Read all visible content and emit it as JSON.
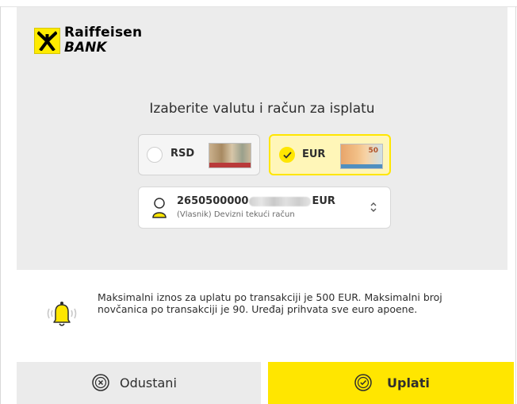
{
  "colors": {
    "brand_yellow": "#ffe600",
    "panel_bg": "#ececec",
    "selected_card_bg": "#fff6b8",
    "text": "#2e2e2e"
  },
  "logo": {
    "brand": "Raiffeisen",
    "bank": "BANK",
    "icon": "raiffeisen-gable-cross-logo"
  },
  "heading": "Izaberite valutu i račun za isplatu",
  "currencies": [
    {
      "code": "RSD",
      "selected": false,
      "note_icon": "rsd-banknote-image"
    },
    {
      "code": "EUR",
      "selected": true,
      "note_icon": "eur-banknote-image",
      "note_value": "50"
    }
  ],
  "account": {
    "number_prefix": "2650500000",
    "number_suffix": "EUR",
    "description": "(Vlasnik) Devizni tekući račun",
    "icon": "user-icon",
    "caret_icon": "updown-caret-icon"
  },
  "info": {
    "icon": "bell-icon",
    "text": "Maksimalni iznos za uplatu po transakciji je 500 EUR. Maksimalni broj novčanica po transakciji je 90. Uređaj prihvata sve euro apoene."
  },
  "buttons": {
    "cancel": {
      "label": "Odustani",
      "icon": "cancel-x-circle-icon"
    },
    "pay": {
      "label": "Uplati",
      "icon": "check-circle-icon"
    }
  }
}
